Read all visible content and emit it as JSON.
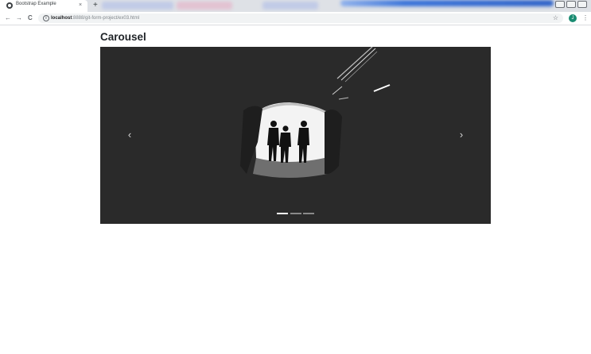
{
  "browser": {
    "active_tab": {
      "title": "Bootstrap Example",
      "close": "×"
    },
    "new_tab": "+",
    "nav": {
      "back": "←",
      "forward": "→",
      "reload": "C"
    },
    "url": {
      "host": "localhost",
      "path": ":8888/git-form-project/ex03.html"
    },
    "info_icon": "i",
    "bookmark_star": "☆",
    "profile_initial": "J",
    "menu": "⋮"
  },
  "page": {
    "title": "Carousel",
    "carousel": {
      "prev": "‹",
      "next": "›",
      "active_indicator": 1,
      "indicator_count": 3
    }
  },
  "colors": {
    "carousel_bg": "#2a2a2a",
    "profile": "#1a8c72",
    "tab_strip": "#dee1e6"
  }
}
